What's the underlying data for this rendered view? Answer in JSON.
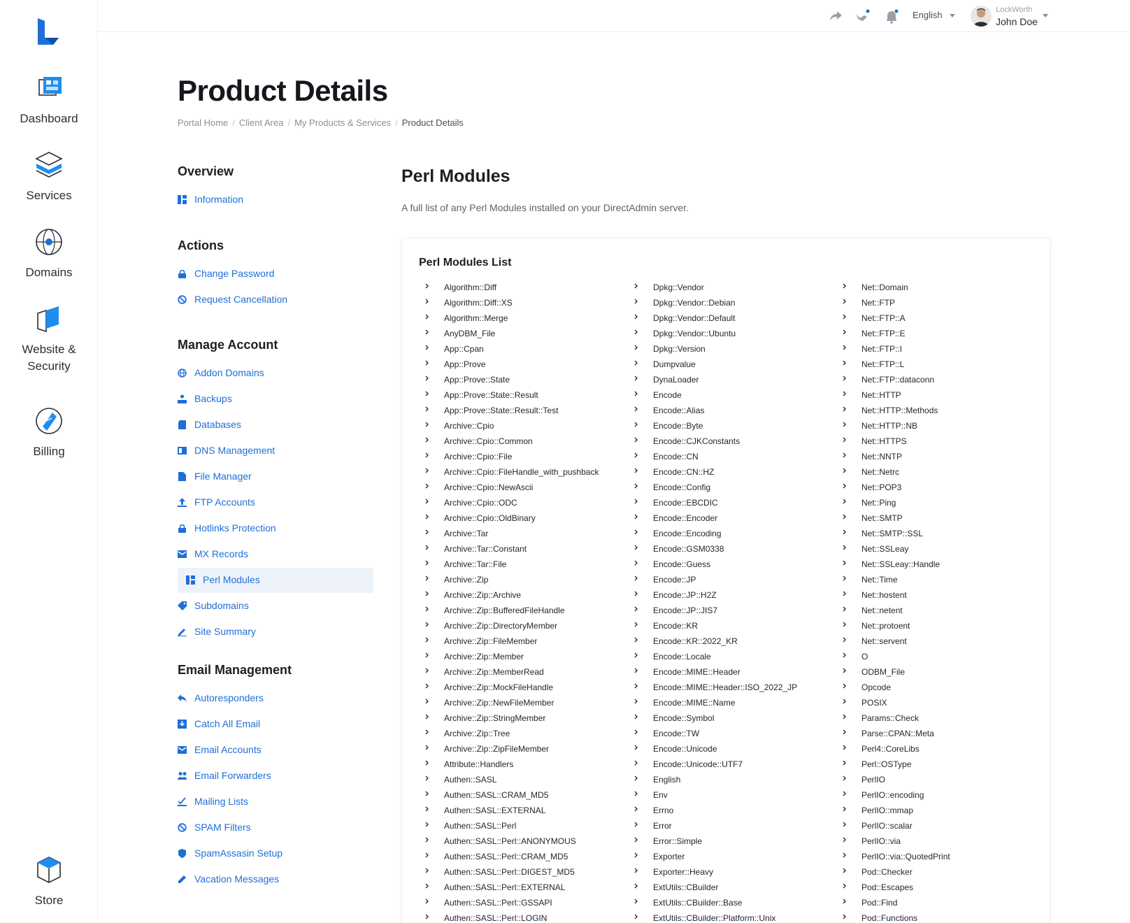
{
  "rail": {
    "items": [
      {
        "label": "Dashboard"
      },
      {
        "label": "Services"
      },
      {
        "label": "Domains"
      },
      {
        "label": "Website & Security"
      },
      {
        "label": "Billing"
      },
      {
        "label": "Store"
      }
    ]
  },
  "topbar": {
    "language": "English",
    "user_org": "LockWorth",
    "user_name": "John Doe"
  },
  "page": {
    "title": "Product Details",
    "breadcrumb": [
      "Portal Home",
      "Client Area",
      "My Products & Services",
      "Product Details"
    ]
  },
  "sidenav": {
    "overview_heading": "Overview",
    "overview": [
      {
        "label": "Information",
        "icon": "dashboard-icon"
      }
    ],
    "actions_heading": "Actions",
    "actions": [
      {
        "label": "Change Password",
        "icon": "lock-icon"
      },
      {
        "label": "Request Cancellation",
        "icon": "ban-icon"
      }
    ],
    "manage_heading": "Manage Account",
    "manage": [
      {
        "label": "Addon Domains",
        "icon": "globe-icon"
      },
      {
        "label": "Backups",
        "icon": "backup-icon"
      },
      {
        "label": "Databases",
        "icon": "database-icon"
      },
      {
        "label": "DNS Management",
        "icon": "dns-icon"
      },
      {
        "label": "File Manager",
        "icon": "file-icon"
      },
      {
        "label": "FTP Accounts",
        "icon": "upload-icon"
      },
      {
        "label": "Hotlinks Protection",
        "icon": "lock-icon"
      },
      {
        "label": "MX Records",
        "icon": "mail-icon"
      },
      {
        "label": "Perl Modules",
        "icon": "dashboard-icon",
        "active": true
      },
      {
        "label": "Subdomains",
        "icon": "tag-icon"
      },
      {
        "label": "Site Summary",
        "icon": "edit-icon"
      }
    ],
    "email_heading": "Email Management",
    "email": [
      {
        "label": "Autoresponders",
        "icon": "reply-icon"
      },
      {
        "label": "Catch All Email",
        "icon": "inbox-icon"
      },
      {
        "label": "Email Accounts",
        "icon": "mail-icon"
      },
      {
        "label": "Email Forwarders",
        "icon": "users-icon"
      },
      {
        "label": "Mailing Lists",
        "icon": "check-list-icon"
      },
      {
        "label": "SPAM Filters",
        "icon": "ban-icon"
      },
      {
        "label": "SpamAssasin Setup",
        "icon": "shield-icon"
      },
      {
        "label": "Vacation Messages",
        "icon": "pencil-icon"
      }
    ]
  },
  "content": {
    "title": "Perl Modules",
    "description": "A full list of any Perl Modules installed on your DirectAdmin server.",
    "list_title": "Perl Modules List",
    "columns": [
      [
        "Algorithm::Diff",
        "Algorithm::Diff::XS",
        "Algorithm::Merge",
        "AnyDBM_File",
        "App::Cpan",
        "App::Prove",
        "App::Prove::State",
        "App::Prove::State::Result",
        "App::Prove::State::Result::Test",
        "Archive::Cpio",
        "Archive::Cpio::Common",
        "Archive::Cpio::File",
        "Archive::Cpio::FileHandle_with_pushback",
        "Archive::Cpio::NewAscii",
        "Archive::Cpio::ODC",
        "Archive::Cpio::OldBinary",
        "Archive::Tar",
        "Archive::Tar::Constant",
        "Archive::Tar::File",
        "Archive::Zip",
        "Archive::Zip::Archive",
        "Archive::Zip::BufferedFileHandle",
        "Archive::Zip::DirectoryMember",
        "Archive::Zip::FileMember",
        "Archive::Zip::Member",
        "Archive::Zip::MemberRead",
        "Archive::Zip::MockFileHandle",
        "Archive::Zip::NewFileMember",
        "Archive::Zip::StringMember",
        "Archive::Zip::Tree",
        "Archive::Zip::ZipFileMember",
        "Attribute::Handlers",
        "Authen::SASL",
        "Authen::SASL::CRAM_MD5",
        "Authen::SASL::EXTERNAL",
        "Authen::SASL::Perl",
        "Authen::SASL::Perl::ANONYMOUS",
        "Authen::SASL::Perl::CRAM_MD5",
        "Authen::SASL::Perl::DIGEST_MD5",
        "Authen::SASL::Perl::EXTERNAL",
        "Authen::SASL::Perl::GSSAPI",
        "Authen::SASL::Perl::LOGIN"
      ],
      [
        "Dpkg::Vendor",
        "Dpkg::Vendor::Debian",
        "Dpkg::Vendor::Default",
        "Dpkg::Vendor::Ubuntu",
        "Dpkg::Version",
        "Dumpvalue",
        "DynaLoader",
        "Encode",
        "Encode::Alias",
        "Encode::Byte",
        "Encode::CJKConstants",
        "Encode::CN",
        "Encode::CN::HZ",
        "Encode::Config",
        "Encode::EBCDIC",
        "Encode::Encoder",
        "Encode::Encoding",
        "Encode::GSM0338",
        "Encode::Guess",
        "Encode::JP",
        "Encode::JP::H2Z",
        "Encode::JP::JIS7",
        "Encode::KR",
        "Encode::KR::2022_KR",
        "Encode::Locale",
        "Encode::MIME::Header",
        "Encode::MIME::Header::ISO_2022_JP",
        "Encode::MIME::Name",
        "Encode::Symbol",
        "Encode::TW",
        "Encode::Unicode",
        "Encode::Unicode::UTF7",
        "English",
        "Env",
        "Errno",
        "Error",
        "Error::Simple",
        "Exporter",
        "Exporter::Heavy",
        "ExtUtils::CBuilder",
        "ExtUtils::CBuilder::Base",
        "ExtUtils::CBuilder::Platform::Unix"
      ],
      [
        "Net::Domain",
        "Net::FTP",
        "Net::FTP::A",
        "Net::FTP::E",
        "Net::FTP::I",
        "Net::FTP::L",
        "Net::FTP::dataconn",
        "Net::HTTP",
        "Net::HTTP::Methods",
        "Net::HTTP::NB",
        "Net::HTTPS",
        "Net::NNTP",
        "Net::Netrc",
        "Net::POP3",
        "Net::Ping",
        "Net::SMTP",
        "Net::SMTP::SSL",
        "Net::SSLeay",
        "Net::SSLeay::Handle",
        "Net::Time",
        "Net::hostent",
        "Net::netent",
        "Net::protoent",
        "Net::servent",
        "O",
        "ODBM_File",
        "Opcode",
        "POSIX",
        "Params::Check",
        "Parse::CPAN::Meta",
        "Perl4::CoreLibs",
        "Perl::OSType",
        "PerlIO",
        "PerlIO::encoding",
        "PerlIO::mmap",
        "PerlIO::scalar",
        "PerlIO::via",
        "PerlIO::via::QuotedPrint",
        "Pod::Checker",
        "Pod::Escapes",
        "Pod::Find",
        "Pod::Functions"
      ]
    ]
  },
  "colors": {
    "accent": "#1f6fd6",
    "active_bg": "#eef3fb"
  }
}
